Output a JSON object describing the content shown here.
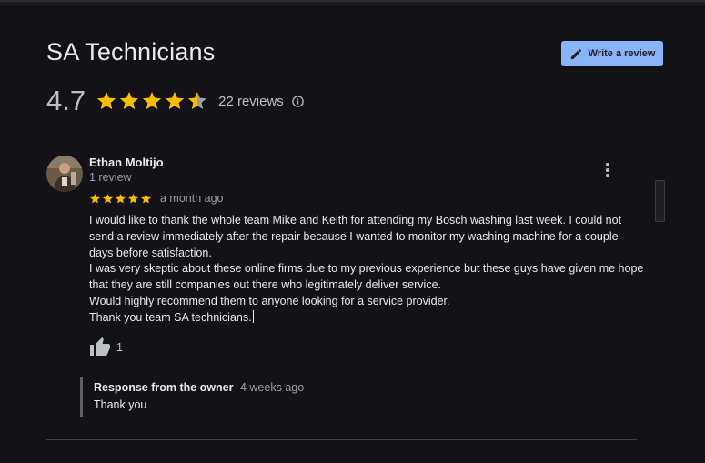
{
  "header": {
    "title": "SA Technicians",
    "write_review_label": "Write a review",
    "rating_value": "4.7",
    "rating_stars": 4.7,
    "reviews_count": "22 reviews",
    "star_color": "#fbbc04",
    "button_color": "#8ab4f8"
  },
  "review": {
    "author": "Ethan Moltijo",
    "author_meta": "1 review",
    "stars": 5,
    "time": "a month ago",
    "paragraphs": [
      "I would like to thank the whole team Mike and Keith for attending my Bosch washing last week. I could not send a review immediately after the repair because I wanted to monitor my washing machine for a couple days before satisfaction.",
      "I was very skeptic about these online firms due to my previous experience but these guys have given me hope that they are still companies out there who legitimately deliver service.",
      "Would highly recommend them to anyone looking for a service provider.",
      "Thank you team SA technicians."
    ],
    "likes": "1",
    "owner_response": {
      "label": "Response from the owner",
      "time": "4 weeks ago",
      "text": "Thank you"
    }
  },
  "icons": [
    "pencil-icon",
    "star-icon",
    "half-star-icon",
    "info-icon",
    "more-vert-icon",
    "thumb-up-icon",
    "avatar"
  ]
}
